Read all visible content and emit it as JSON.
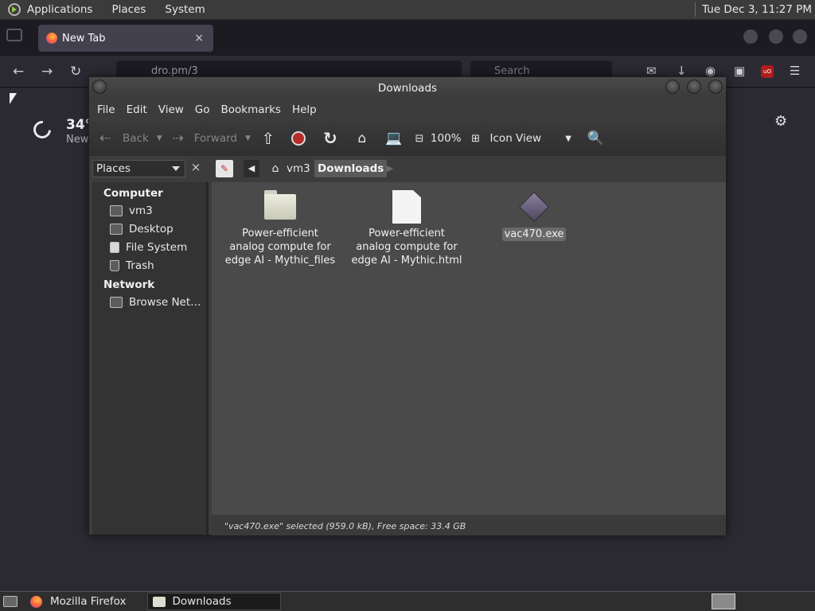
{
  "top_panel": {
    "menus": [
      "Applications",
      "Places",
      "System"
    ],
    "clock": "Tue Dec  3, 11:27 PM"
  },
  "firefox": {
    "tab_title": "New Tab",
    "tab_close": "×",
    "url_text": "dro.pm/3",
    "search_placeholder": "Search",
    "weather_temp": "34°",
    "weather_location": "New",
    "ublock_badge": "uO"
  },
  "nautilus": {
    "title": "Downloads",
    "menus": [
      "File",
      "Edit",
      "View",
      "Go",
      "Bookmarks",
      "Help"
    ],
    "toolbar": {
      "back": "Back",
      "forward": "Forward",
      "zoom": "100%",
      "view_mode": "Icon View"
    },
    "sidebar_selector": "Places",
    "sidebar_close": "×",
    "breadcrumbs": [
      "vm3",
      "Downloads"
    ],
    "sidebar": {
      "computer_heading": "Computer",
      "computer_items": [
        "vm3",
        "Desktop",
        "File System",
        "Trash"
      ],
      "network_heading": "Network",
      "network_items": [
        "Browse Net…"
      ]
    },
    "files": [
      {
        "name": "Power-efficient analog compute for edge AI - Mythic_files",
        "type": "folder"
      },
      {
        "name": "Power-efficient analog compute for edge AI - Mythic.html",
        "type": "html-document"
      },
      {
        "name": "vac470.exe",
        "type": "executable",
        "selected": true
      }
    ],
    "status": "\"vac470.exe\" selected (959.0 kB), Free space: 33.4 GB"
  },
  "taskbar": {
    "items": [
      "Mozilla Firefox",
      "Downloads"
    ],
    "active": "Downloads"
  }
}
